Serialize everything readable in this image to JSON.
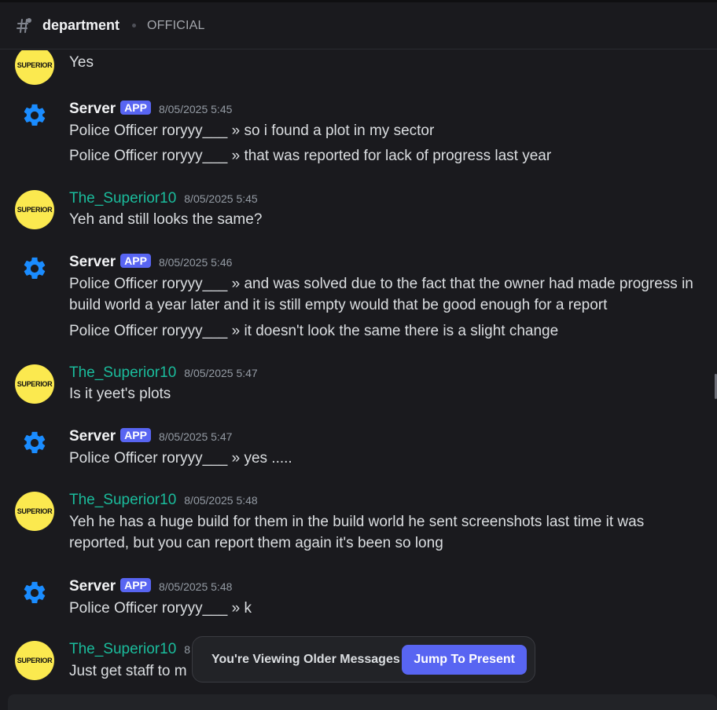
{
  "header": {
    "channel": "department",
    "topic": "OFFICIAL"
  },
  "colors": {
    "accent": "#5865f2",
    "teal_name": "#1abc9c",
    "avatar_yellow": "#fbe94f",
    "gear_blue": "#1a8cff"
  },
  "messages": [
    {
      "type": "user-cont",
      "avatar_text": "SUPERIOR",
      "lines": [
        "Yes"
      ]
    },
    {
      "type": "server",
      "author": "Server",
      "badge": "APP",
      "time": "8/05/2025 5:45",
      "lines": [
        "Police Officer roryyy___ » so i found a plot in my sector",
        "Police Officer roryyy___ » that was reported for lack of progress last year"
      ]
    },
    {
      "type": "user",
      "author": "The_Superior10",
      "avatar_text": "SUPERIOR",
      "time": "8/05/2025 5:45",
      "lines": [
        "Yeh and still looks the same?"
      ]
    },
    {
      "type": "server",
      "author": "Server",
      "badge": "APP",
      "time": "8/05/2025 5:46",
      "lines": [
        "Police Officer roryyy___ » and was solved due to the fact that the owner had made progress in build world a year later and it is still empty would that be good enough for a report",
        "Police Officer roryyy___ » it doesn't look the same there is a slight change"
      ]
    },
    {
      "type": "user",
      "author": "The_Superior10",
      "avatar_text": "SUPERIOR",
      "time": "8/05/2025 5:47",
      "lines": [
        "Is it yeet's plots"
      ]
    },
    {
      "type": "server",
      "author": "Server",
      "badge": "APP",
      "time": "8/05/2025 5:47",
      "lines": [
        "Police Officer roryyy___ » yes ....."
      ]
    },
    {
      "type": "user",
      "author": "The_Superior10",
      "avatar_text": "SUPERIOR",
      "time": "8/05/2025 5:48",
      "lines": [
        "Yeh he has a huge build for them in the build world he sent screenshots last time it was reported, but you can report them again it's been so long"
      ]
    },
    {
      "type": "server",
      "author": "Server",
      "badge": "APP",
      "time": "8/05/2025 5:48",
      "lines": [
        "Police Officer roryyy___ » k"
      ]
    },
    {
      "type": "user",
      "author": "The_Superior10",
      "avatar_text": "SUPERIOR",
      "time_partial": "8",
      "lines": [
        "Just get staff to m"
      ]
    }
  ],
  "jump": {
    "text": "You're Viewing Older Messages",
    "button": "Jump To Present"
  }
}
